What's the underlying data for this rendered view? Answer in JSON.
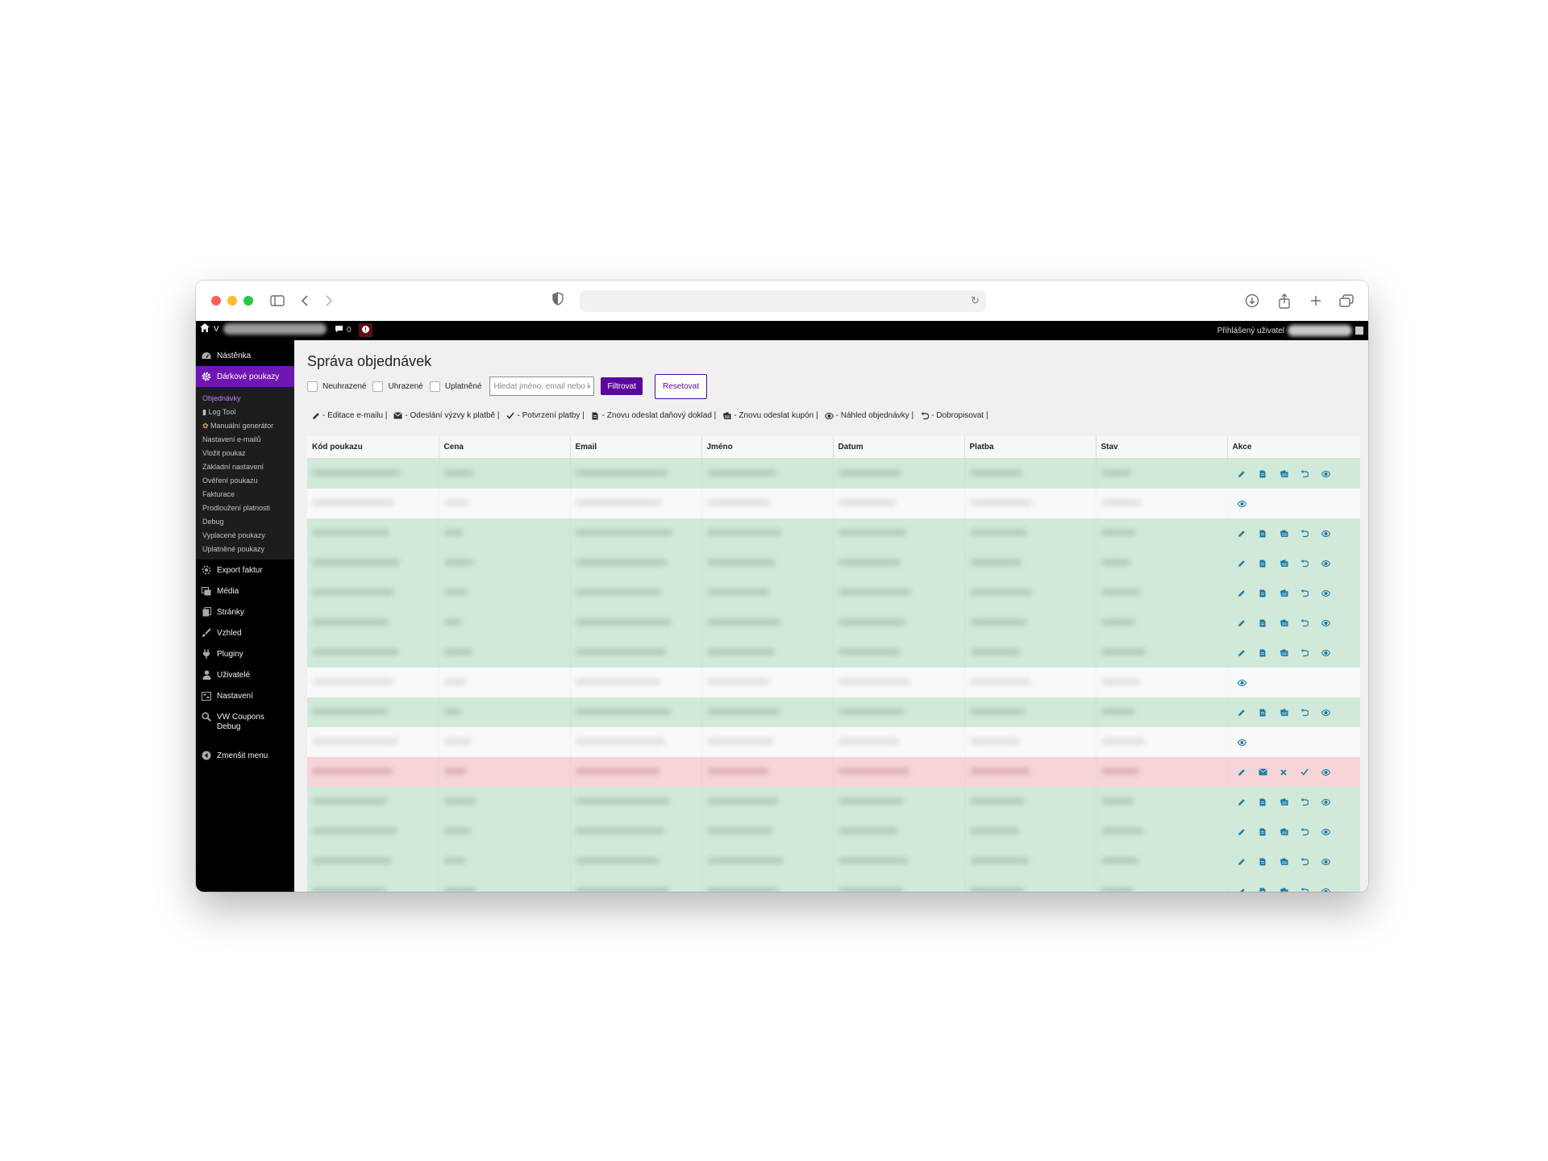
{
  "browser": {
    "url": ""
  },
  "adminbar": {
    "site_initial": "V",
    "comments_count": "0",
    "user_label": "Přihlášený uživatel"
  },
  "sidebar": {
    "menu_top": [
      {
        "label": "Nástěnka",
        "icon": "dashboard-icon"
      },
      {
        "label": "Dárkové poukazy",
        "icon": "gear-icon",
        "active": true
      }
    ],
    "submenu": [
      "Objednávky",
      "Log Tool",
      "Manuální generátor",
      "Nastavení e-mailů",
      "Vložit poukaz",
      "Základní nastavení",
      "Ověření poukazu",
      "Fakturace",
      "Prodloužení platnosti",
      "Debug",
      "Vyplacené poukazy",
      "Uplatněné poukazy"
    ],
    "menu_bottom": [
      {
        "label": "Export faktur",
        "icon": "gear-icon"
      },
      {
        "label": "Média",
        "icon": "media-icon"
      },
      {
        "label": "Stránky",
        "icon": "pages-icon"
      },
      {
        "label": "Vzhled",
        "icon": "brush-icon"
      },
      {
        "label": "Pluginy",
        "icon": "plugin-icon"
      },
      {
        "label": "Uživatelé",
        "icon": "user-icon"
      },
      {
        "label": "Nastavení",
        "icon": "settings-icon"
      },
      {
        "label": "VW Coupons Debug",
        "icon": "search-icon"
      },
      {
        "label": "Zmenšit menu",
        "icon": "collapse-icon"
      }
    ]
  },
  "page": {
    "title": "Správa objednávek",
    "filters": {
      "unpaid": "Neuhrazené",
      "paid": "Uhrazené",
      "redeemed": "Uplatněné"
    },
    "search_placeholder": "Hledat jméno, email nebo kód",
    "filter_button": "Filtrovat",
    "reset_button": "Resetovat",
    "legend": [
      {
        "icon": "edit-icon",
        "text": "- Editace e-mailu |"
      },
      {
        "icon": "mail-icon",
        "text": "- Odeslání výzvy k platbě |"
      },
      {
        "icon": "check-icon",
        "text": "- Potvrzení platby |"
      },
      {
        "icon": "document-icon",
        "text": "- Znovu odeslat daňový doklad |"
      },
      {
        "icon": "ticket-icon",
        "text": "- Znovu odeslat kupón |"
      },
      {
        "icon": "eye-icon",
        "text": "- Náhled objednávky |"
      },
      {
        "icon": "undo-icon",
        "text": "- Dobropisovat |"
      }
    ]
  },
  "table": {
    "columns": [
      "Kód poukazu",
      "Cena",
      "Email",
      "Jméno",
      "Datum",
      "Platba",
      "Stav",
      "Akce"
    ],
    "rows": [
      {
        "status": "paid",
        "actions": [
          "edit-icon",
          "document-icon",
          "ticket-icon",
          "undo-icon",
          "eye-icon"
        ]
      },
      {
        "status": "unpaid",
        "actions": [
          "eye-icon"
        ]
      },
      {
        "status": "paid",
        "actions": [
          "edit-icon",
          "document-icon",
          "ticket-icon",
          "undo-icon",
          "eye-icon"
        ]
      },
      {
        "status": "paid",
        "actions": [
          "edit-icon",
          "document-icon",
          "ticket-icon",
          "undo-icon",
          "eye-icon"
        ]
      },
      {
        "status": "paid",
        "actions": [
          "edit-icon",
          "document-icon",
          "ticket-icon",
          "undo-icon",
          "eye-icon"
        ]
      },
      {
        "status": "paid",
        "actions": [
          "edit-icon",
          "document-icon",
          "ticket-icon",
          "undo-icon",
          "eye-icon"
        ]
      },
      {
        "status": "paid",
        "actions": [
          "edit-icon",
          "document-icon",
          "ticket-icon",
          "undo-icon",
          "eye-icon"
        ]
      },
      {
        "status": "unpaid",
        "actions": [
          "eye-icon"
        ]
      },
      {
        "status": "paid",
        "actions": [
          "edit-icon",
          "document-icon",
          "ticket-icon",
          "undo-icon",
          "eye-icon"
        ]
      },
      {
        "status": "unpaid",
        "actions": [
          "eye-icon"
        ]
      },
      {
        "status": "redeemed",
        "actions": [
          "edit-icon",
          "mail-icon",
          "cross-icon",
          "check-icon",
          "eye-icon"
        ]
      },
      {
        "status": "paid",
        "actions": [
          "edit-icon",
          "document-icon",
          "ticket-icon",
          "undo-icon",
          "eye-icon"
        ]
      },
      {
        "status": "paid",
        "actions": [
          "edit-icon",
          "document-icon",
          "ticket-icon",
          "undo-icon",
          "eye-icon"
        ]
      },
      {
        "status": "paid",
        "actions": [
          "edit-icon",
          "document-icon",
          "ticket-icon",
          "undo-icon",
          "eye-icon"
        ]
      },
      {
        "status": "paid",
        "actions": [
          "edit-icon",
          "document-icon",
          "ticket-icon",
          "undo-icon",
          "eye-icon"
        ]
      }
    ]
  },
  "colors": {
    "accent": "#7016b5",
    "button": "#5a079c",
    "row_paid": "#d1e9d9",
    "row_unpaid": "#f9f9f9",
    "row_redeemed": "#f5d5d8",
    "action_icon": "#1c7ca8"
  }
}
